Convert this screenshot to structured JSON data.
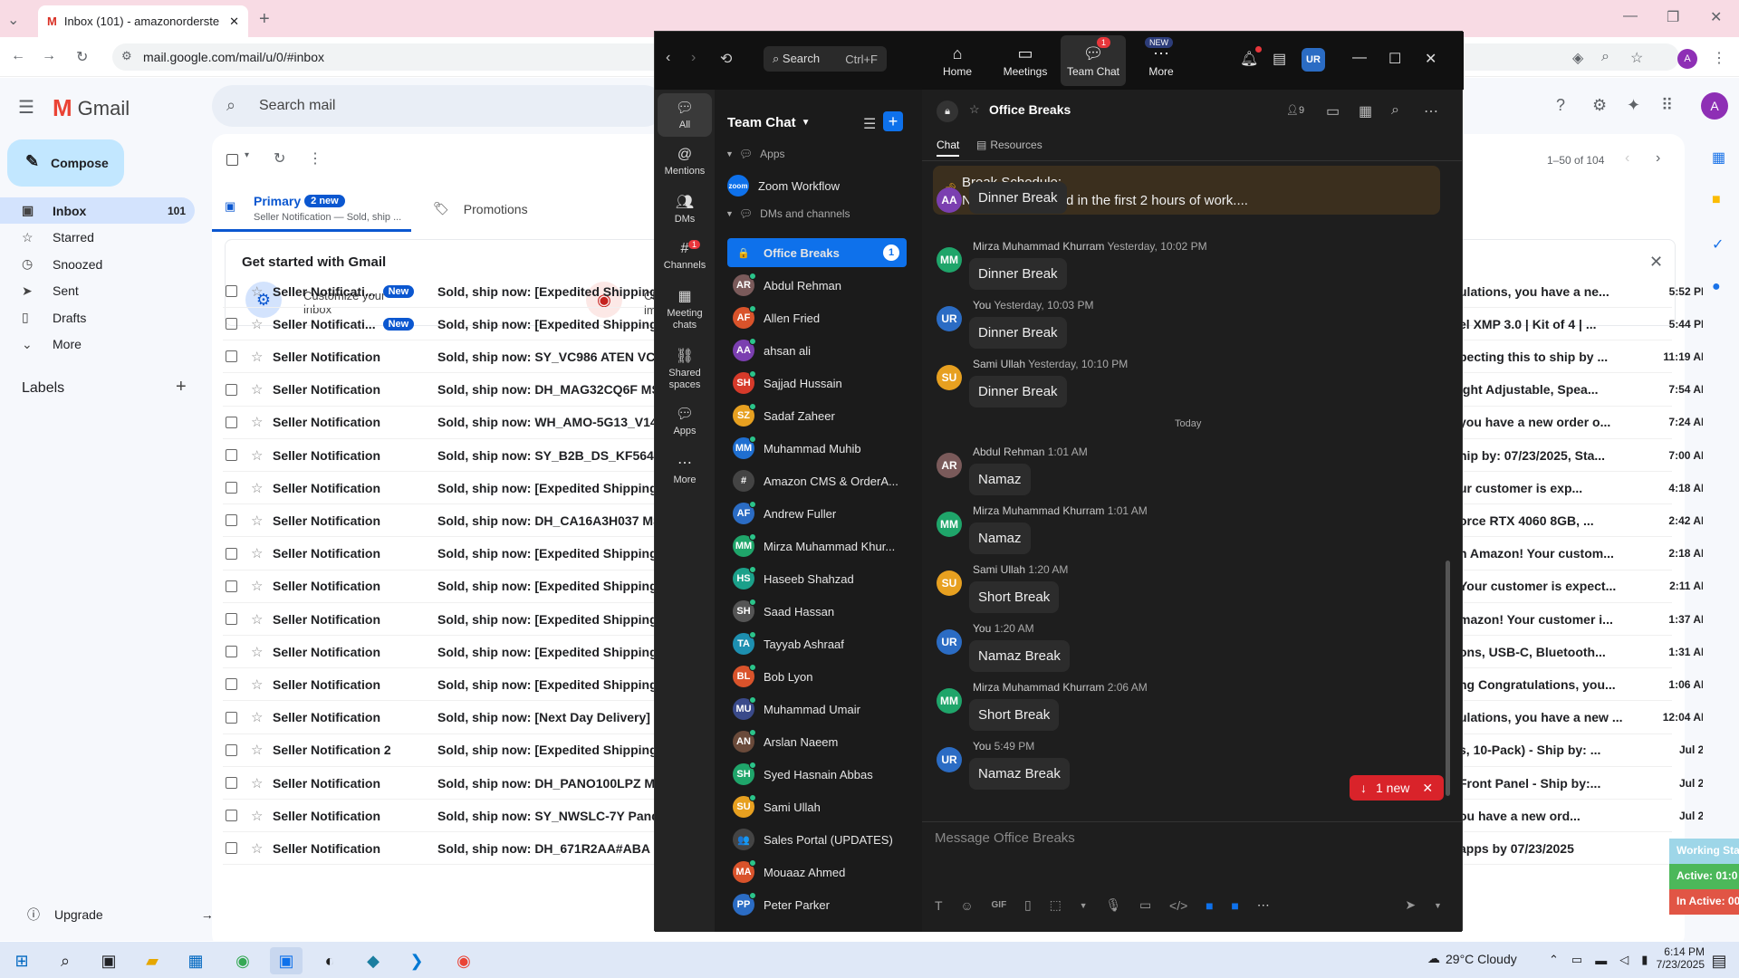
{
  "browser": {
    "tab_title": "Inbox (101) - amazonorderste",
    "url": "mail.google.com/mail/u/0/#inbox"
  },
  "gmail": {
    "logo": "Gmail",
    "search_placeholder": "Search mail",
    "compose": "Compose",
    "nav": [
      {
        "label": "Inbox",
        "count": "101",
        "icon": "inbox-icon"
      },
      {
        "label": "Starred",
        "count": "",
        "icon": "star-icon"
      },
      {
        "label": "Snoozed",
        "count": "",
        "icon": "clock-icon"
      },
      {
        "label": "Sent",
        "count": "",
        "icon": "send-icon"
      },
      {
        "label": "Drafts",
        "count": "",
        "icon": "draft-icon"
      },
      {
        "label": "More",
        "count": "",
        "icon": "chevron-down-icon"
      }
    ],
    "labels_title": "Labels",
    "upgrade": "Upgrade",
    "pagination": "1–50 of 104",
    "tabs": {
      "primary": "Primary",
      "primary_badge": "2 new",
      "primary_sub": "Seller Notification — Sold, ship ...",
      "promotions": "Promotions"
    },
    "getstarted": {
      "title": "Get started with Gmail",
      "customize": "Customize your inbox",
      "change": "Cha",
      "change2": "ima"
    },
    "rows": [
      {
        "sender": "Seller Notificati...",
        "tag": "New",
        "subject": "Sold, ship now: [Expedited Shipping] S",
        "snippet": "ulations, you have a ne...",
        "time": "5:52 PM"
      },
      {
        "sender": "Seller Notificati...",
        "tag": "New",
        "subject": "Sold, ship now: [Expedited Shipping] I",
        "snippet": "el XMP 3.0 | Kit of 4 | ...",
        "time": "5:44 PM"
      },
      {
        "sender": "Seller Notification",
        "tag": "",
        "subject": "Sold, ship now: SY_VC986 ATEN VC986",
        "snippet": "pecting this to ship by ...",
        "time": "11:19 AM"
      },
      {
        "sender": "Seller Notification",
        "tag": "",
        "subject": "Sold, ship now: DH_MAG32CQ6F MSI M",
        "snippet": "ight Adjustable, Spea...",
        "time": "7:54 AM"
      },
      {
        "sender": "Seller Notification",
        "tag": "",
        "subject": "Sold, ship now: WH_AMO-5G13_V1441 I",
        "snippet": "you have a new order o...",
        "time": "7:24 AM"
      },
      {
        "sender": "Seller Notification",
        "tag": "",
        "subject": "Sold, ship now: SY_B2B_DS_KF564C32R",
        "snippet": "hip by: 07/23/2025, Sta...",
        "time": "7:00 AM"
      },
      {
        "sender": "Seller Notification",
        "tag": "",
        "subject": "Sold, ship now: [Expedited Shipping] S",
        "snippet": "ur customer is exp...",
        "time": "4:18 AM"
      },
      {
        "sender": "Seller Notification",
        "tag": "",
        "subject": "Sold, ship now: DH_CA16A3H037 MSI C",
        "snippet": "orce RTX 4060 8GB, ...",
        "time": "2:42 AM"
      },
      {
        "sender": "Seller Notification",
        "tag": "",
        "subject": "Sold, ship now: [Expedited Shipping] S",
        "snippet": "n Amazon! Your custom...",
        "time": "2:18 AM"
      },
      {
        "sender": "Seller Notification",
        "tag": "",
        "subject": "Sold, ship now: [Expedited Shipping] S",
        "snippet": "Your customer is expect...",
        "time": "2:11 AM"
      },
      {
        "sender": "Seller Notification",
        "tag": "",
        "subject": "Sold, ship now: [Expedited Shipping] S",
        "snippet": "mazon! Your customer i...",
        "time": "1:37 AM"
      },
      {
        "sender": "Seller Notification",
        "tag": "",
        "subject": "Sold, ship now: [Expedited Shipping] D",
        "snippet": "ons, USB-C, Bluetooth...",
        "time": "1:31 AM"
      },
      {
        "sender": "Seller Notification",
        "tag": "",
        "subject": "Sold, ship now: [Expedited Shipping] I",
        "snippet": "ng Congratulations, you...",
        "time": "1:06 AM"
      },
      {
        "sender": "Seller Notification",
        "tag": "",
        "subject": "Sold, ship now: [Next Day Delivery] SS",
        "snippet": "ulations, you have a new ...",
        "time": "12:04 AM"
      },
      {
        "sender": "Seller Notification 2",
        "tag": "",
        "subject": "Sold, ship now: [Expedited Shipping] S",
        "snippet": "s, 10-Pack) - Ship by: ...",
        "time": "Jul 22"
      },
      {
        "sender": "Seller Notification",
        "tag": "",
        "subject": "Sold, ship now: DH_PANO100LPZ MSI M",
        "snippet": "Front Panel - Ship by:...",
        "time": "Jul 22"
      },
      {
        "sender": "Seller Notification",
        "tag": "",
        "subject": "Sold, ship now: SY_NWSLC-7Y Panduit",
        "snippet": "ou have a new ord...",
        "time": "Jul 22"
      },
      {
        "sender": "Seller Notification",
        "tag": "",
        "subject": "Sold, ship now: DH_671R2AA#ABA HP",
        "snippet": "apps by 07/23/2025",
        "time": ""
      }
    ]
  },
  "zoom": {
    "search": "Search",
    "search_shortcut": "Ctrl+F",
    "tabs": [
      {
        "label": "Home",
        "icon": "home-icon",
        "badge": ""
      },
      {
        "label": "Meetings",
        "icon": "video-icon",
        "badge": ""
      },
      {
        "label": "Team Chat",
        "icon": "chat-icon",
        "badge": "1"
      },
      {
        "label": "More",
        "icon": "more-icon",
        "badge": "NEW"
      }
    ],
    "avatar": "UR",
    "rail": [
      {
        "label": "All",
        "icon": "chat-icon",
        "badge": ""
      },
      {
        "label": "Mentions",
        "icon": "at-icon",
        "badge": ""
      },
      {
        "label": "DMs",
        "icon": "people-icon",
        "badge": ""
      },
      {
        "label": "Channels",
        "icon": "hash-icon",
        "badge": "1"
      },
      {
        "label": "Meeting chats",
        "icon": "calendar-icon",
        "badge": ""
      },
      {
        "label": "Shared spaces",
        "icon": "link-icon",
        "badge": ""
      },
      {
        "label": "Apps",
        "icon": "apps-icon",
        "badge": ""
      },
      {
        "label": "More",
        "icon": "more-icon",
        "badge": ""
      }
    ],
    "list_title": "Team Chat",
    "apps_header": "Apps",
    "zoom_workflow": "Zoom Workflow",
    "dms_header": "DMs and channels",
    "channels": [
      {
        "name": "Office Breaks",
        "initials": "🔒",
        "color": "#0e71eb",
        "badge": "1",
        "active": true
      },
      {
        "name": "Abdul Rehman",
        "initials": "AR",
        "color": "#7a5a5a",
        "badge": ""
      },
      {
        "name": "Allen Fried",
        "initials": "AF",
        "color": "#d9532b",
        "badge": ""
      },
      {
        "name": "ahsan ali",
        "initials": "AA",
        "color": "#7b3fb0",
        "badge": ""
      },
      {
        "name": "Sajjad Hussain",
        "initials": "SH",
        "color": "#d63a2a",
        "badge": ""
      },
      {
        "name": "Sadaf Zaheer",
        "initials": "SZ",
        "color": "#e7a020",
        "badge": ""
      },
      {
        "name": "Muhammad Muhib",
        "initials": "MM",
        "color": "#1f6fd1",
        "badge": ""
      },
      {
        "name": "Amazon CMS & OrderA...",
        "initials": "#",
        "color": "#444",
        "badge": ""
      },
      {
        "name": "Andrew Fuller",
        "initials": "AF",
        "color": "#2b6cc4",
        "badge": ""
      },
      {
        "name": "Mirza Muhammad Khur...",
        "initials": "MM",
        "color": "#1fa56a",
        "badge": ""
      },
      {
        "name": "Haseeb Shahzad",
        "initials": "HS",
        "color": "#1ba08a",
        "badge": ""
      },
      {
        "name": "Saad Hassan",
        "initials": "SH",
        "color": "#555",
        "badge": ""
      },
      {
        "name": "Tayyab Ashraaf",
        "initials": "TA",
        "color": "#1d8fb0",
        "badge": ""
      },
      {
        "name": "Bob Lyon",
        "initials": "BL",
        "color": "#d9532b",
        "badge": ""
      },
      {
        "name": "Muhammad Umair",
        "initials": "MU",
        "color": "#3a4a8a",
        "badge": ""
      },
      {
        "name": "Arslan Naeem",
        "initials": "AN",
        "color": "#6a4a3a",
        "badge": ""
      },
      {
        "name": "Syed Hasnain Abbas",
        "initials": "SH",
        "color": "#1fa56a",
        "badge": ""
      },
      {
        "name": "Sami Ullah",
        "initials": "SU",
        "color": "#e7a020",
        "badge": ""
      },
      {
        "name": "Sales Portal (UPDATES)",
        "initials": "👥",
        "color": "#444",
        "badge": ""
      },
      {
        "name": "Mouaaz Ahmed",
        "initials": "MA",
        "color": "#d9532b",
        "badge": ""
      },
      {
        "name": "Peter Parker",
        "initials": "PP",
        "color": "#2b6cc4",
        "badge": ""
      }
    ],
    "chat_title": "Office Breaks",
    "member_count": "9",
    "tab_chat": "Chat",
    "tab_resources": "Resources",
    "pinned_title": "Break Schedule:",
    "pinned_text": "No breaks allowed in the first 2 hours of work....",
    "today": "Today",
    "messages": [
      {
        "initials": "AA",
        "color": "#7b3fb0",
        "name": "",
        "time": "",
        "text": "Dinner Break"
      },
      {
        "initials": "MM",
        "color": "#1fa56a",
        "name": "Mirza Muhammad Khurram",
        "time": "Yesterday, 10:02 PM",
        "text": "Dinner Break"
      },
      {
        "initials": "UR",
        "color": "#2b6cc4",
        "name": "You",
        "time": "Yesterday, 10:03 PM",
        "text": "Dinner Break"
      },
      {
        "initials": "SU",
        "color": "#e7a020",
        "name": "Sami Ullah",
        "time": "Yesterday, 10:10 PM",
        "text": "Dinner Break"
      },
      {
        "initials": "AR",
        "color": "#7a5a5a",
        "name": "Abdul Rehman",
        "time": "1:01 AM",
        "text": "Namaz"
      },
      {
        "initials": "MM",
        "color": "#1fa56a",
        "name": "Mirza Muhammad Khurram",
        "time": "1:01 AM",
        "text": "Namaz"
      },
      {
        "initials": "SU",
        "color": "#e7a020",
        "name": "Sami Ullah",
        "time": "1:20 AM",
        "text": "Short Break"
      },
      {
        "initials": "UR",
        "color": "#2b6cc4",
        "name": "You",
        "time": "1:20 AM",
        "text": "Namaz Break"
      },
      {
        "initials": "MM",
        "color": "#1fa56a",
        "name": "Mirza Muhammad Khurram",
        "time": "2:06 AM",
        "text": "Short Break"
      },
      {
        "initials": "UR",
        "color": "#2b6cc4",
        "name": "You",
        "time": "5:49 PM",
        "text": "Namaz Break"
      }
    ],
    "new_pill": "1 new",
    "composer_placeholder": "Message Office Breaks"
  },
  "side_widget": {
    "working": "Working Sta",
    "active": "Active: 01:0",
    "inactive": "In Active: 00"
  },
  "taskbar": {
    "weather": "29°C  Cloudy",
    "time": "6:14 PM",
    "date": "7/23/2025"
  }
}
